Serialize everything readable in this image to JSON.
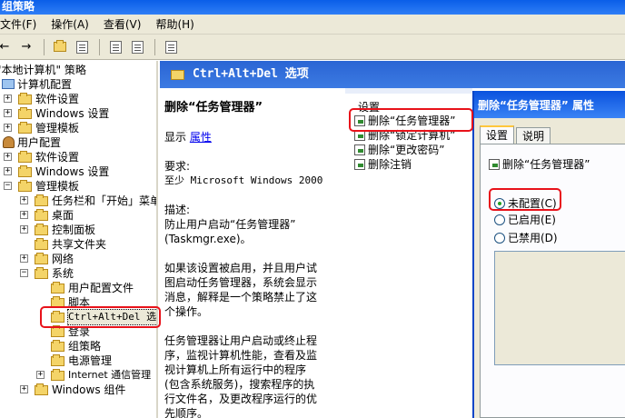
{
  "window": {
    "title": "组策略"
  },
  "menu": [
    "文件(F)",
    "操作(A)",
    "查看(V)",
    "帮助(H)"
  ],
  "toolbar": {
    "buttons": [
      "back-arrow-icon",
      "forward-arrow-icon",
      "up-folder-icon",
      "show-tree-icon",
      "properties-icon",
      "export-list-icon",
      "help-icon"
    ]
  },
  "tree": {
    "rows": [
      {
        "label": "\"本地计算机\" 策略",
        "indent": 0
      },
      {
        "label": "计算机配置",
        "indent": 0
      },
      {
        "label": "软件设置",
        "indent": 1
      },
      {
        "label": "Windows 设置",
        "indent": 1
      },
      {
        "label": "管理模板",
        "indent": 1
      },
      {
        "label": "用户配置",
        "indent": 0
      },
      {
        "label": "软件设置",
        "indent": 1
      },
      {
        "label": "Windows 设置",
        "indent": 1
      },
      {
        "label": "管理模板",
        "indent": 1
      },
      {
        "label": "任务栏和「开始」菜单",
        "indent": 2
      },
      {
        "label": "桌面",
        "indent": 2
      },
      {
        "label": "控制面板",
        "indent": 2
      },
      {
        "label": "共享文件夹",
        "indent": 2
      },
      {
        "label": "网络",
        "indent": 2
      },
      {
        "label": "系统",
        "indent": 2
      },
      {
        "label": "用户配置文件",
        "indent": 3
      },
      {
        "label": "脚本",
        "indent": 3
      },
      {
        "label": "Ctrl+Alt+Del 选项",
        "indent": 3
      },
      {
        "label": "登录",
        "indent": 3
      },
      {
        "label": "组策略",
        "indent": 3
      },
      {
        "label": "电源管理",
        "indent": 3
      },
      {
        "label": "Internet 通信管理",
        "indent": 3
      },
      {
        "label": "Windows 组件",
        "indent": 2
      }
    ]
  },
  "header": {
    "title": "Ctrl+Alt+Del 选项"
  },
  "description": {
    "title": "删除“任务管理器”",
    "display_prefix": "显示",
    "properties_link": "属性",
    "requirement_label": "要求:",
    "requirement_value": "至少 Microsoft Windows 2000",
    "desc_label": "描述:",
    "desc_line1": "防止用户启动“任务管理器”",
    "desc_line2": "(Taskmgr.exe)。",
    "para2": [
      "如果该设置被启用，并且用户试",
      "图启动任务管理器，系统会显示",
      "消息，解释是一个策略禁止了这",
      "个操作。"
    ],
    "para3": [
      "任务管理器让用户启动或终止程",
      "序，监视计算机性能，查看及监",
      "视计算机上所有运行中的程序",
      "(包含系统服务)，搜索程序的执",
      "行文件名，及更改程序运行的优",
      "先顺序。"
    ]
  },
  "settings": {
    "header": "设置",
    "items": [
      "删除“任务管理器”",
      "删除“锁定计算机”",
      "删除“更改密码”",
      "删除注销"
    ]
  },
  "dialog": {
    "title": "删除“任务管理器” 属性",
    "tabs": [
      "设置",
      "说明"
    ],
    "policy_name": "删除“任务管理器”",
    "options": [
      "未配置(C)",
      "已启用(E)",
      "已禁用(D)"
    ],
    "selected": "未配置(C)"
  },
  "colors": {
    "accent": "#2a65d4",
    "highlight": "#e8121a",
    "dialog_bg": "#ece9d8"
  }
}
